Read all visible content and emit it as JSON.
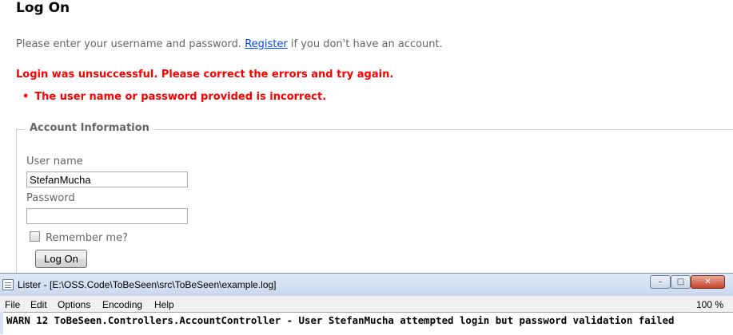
{
  "page": {
    "title": "Log On",
    "intro_before": "Please enter your username and password.",
    "register_link": "Register",
    "intro_after": "if you don't have an account.",
    "error_summary": "Login was unsuccessful. Please correct the errors and try again.",
    "errors": [
      "The user name or password provided is incorrect."
    ],
    "fieldset_legend": "Account Information",
    "username_label": "User name",
    "username_value": "StefanMucha",
    "password_label": "Password",
    "password_value": "",
    "remember_label": "Remember me?",
    "remember_checked": false,
    "logon_button": "Log On"
  },
  "lister": {
    "title": "Lister - [E:\\OSS.Code\\ToBeSeen\\src\\ToBeSeen\\example.log]",
    "menu": [
      "File",
      "Edit",
      "Options",
      "Encoding",
      "Help"
    ],
    "zoom": "100 %",
    "log_line": "WARN 12 ToBeSeen.Controllers.AccountController - User StefanMucha attempted login but password validation failed"
  },
  "icons": {
    "app": "list-document-icon",
    "minimize": "minimize-icon",
    "maximize": "maximize-icon",
    "close": "close-icon"
  },
  "colors": {
    "error": "#ff0000",
    "link": "#034af3"
  }
}
